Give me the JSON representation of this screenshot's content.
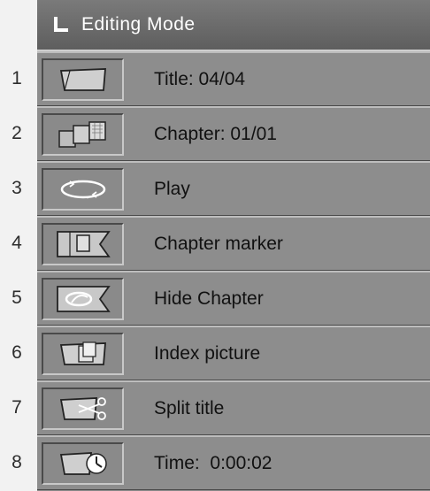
{
  "header": {
    "title": "Editing Mode",
    "icon": "corner-arrow-icon"
  },
  "menu": {
    "items": [
      {
        "number": "1",
        "label": "Title: 04/04",
        "icon": "title-icon"
      },
      {
        "number": "2",
        "label": "Chapter: 01/01",
        "icon": "chapter-icon"
      },
      {
        "number": "3",
        "label": "Play",
        "icon": "play-loop-icon"
      },
      {
        "number": "4",
        "label": "Chapter marker",
        "icon": "chapter-marker-icon"
      },
      {
        "number": "5",
        "label": "Hide Chapter",
        "icon": "hide-chapter-icon"
      },
      {
        "number": "6",
        "label": "Index picture",
        "icon": "index-picture-icon"
      },
      {
        "number": "7",
        "label": "Split title",
        "icon": "split-title-icon"
      },
      {
        "number": "8",
        "label": "Time:  0:00:02",
        "icon": "time-icon"
      }
    ]
  },
  "colors": {
    "header_bg": "#6a6a6a",
    "row_bg": "#8d8d8d",
    "text": "#111111",
    "header_text": "#ffffff",
    "page_bg": "#f2f2f2"
  }
}
